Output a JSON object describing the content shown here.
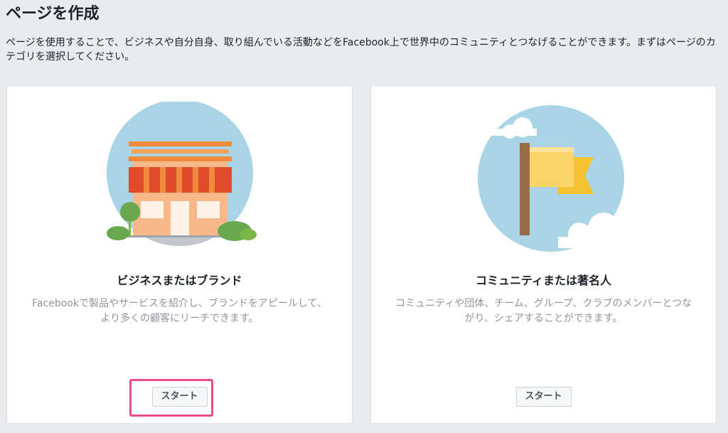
{
  "page": {
    "title": "ページを作成",
    "description": "ページを使用することで、ビジネスや自分自身、取り組んでいる活動などをFacebook上で世界中のコミュニティとつなげることができます。まずはページのカテゴリを選択してください。"
  },
  "cards": [
    {
      "title": "ビジネスまたはブランド",
      "description": "Facebookで製品やサービスを紹介し、ブランドをアピールして、より多くの顧客にリーチできます。",
      "button_label": "スタート",
      "icon": "storefront-icon"
    },
    {
      "title": "コミュニティまたは著名人",
      "description": "コミュニティや団体、チーム、グループ、クラブのメンバーとつながり、シェアすることができます。",
      "button_label": "スタート",
      "icon": "flag-icon"
    }
  ],
  "colors": {
    "background": "#e9ebee",
    "highlight": "#ea4c89",
    "illustration_circle": "#a8d4e6",
    "awning_red": "#e04b2a",
    "roof_orange": "#f08a3c",
    "flag_yellow": "#fcd46a",
    "pole_brown": "#9b6b43"
  }
}
